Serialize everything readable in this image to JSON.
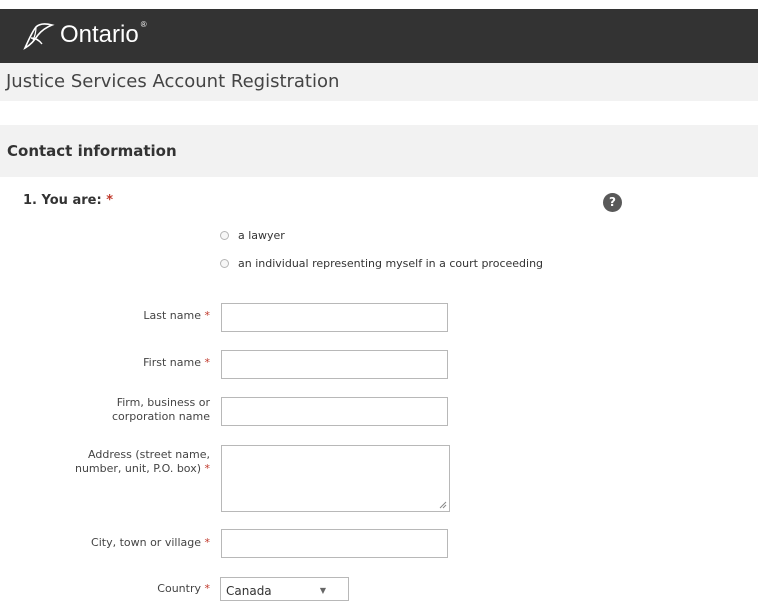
{
  "header": {
    "logo_text": "Ontario",
    "logo_mark": "trillium-logo",
    "tm": "®"
  },
  "page": {
    "title": "Justice Services Account Registration"
  },
  "section": {
    "title": "Contact information"
  },
  "question1": {
    "label": "1. You are:",
    "required_mark": "*",
    "help_icon": "?",
    "options": [
      "a lawyer",
      "an individual representing myself in a court proceeding"
    ]
  },
  "fields": {
    "last_name": {
      "label": "Last name",
      "required_mark": "*",
      "value": ""
    },
    "first_name": {
      "label": "First name",
      "required_mark": "*",
      "value": ""
    },
    "firm": {
      "label_line1": "Firm, business or",
      "label_line2": "corporation name",
      "value": ""
    },
    "address": {
      "label_line1": "Address (street name,",
      "label_line2": "number, unit, P.O. box)",
      "required_mark": "*",
      "value": ""
    },
    "city": {
      "label": "City, town or village",
      "required_mark": "*",
      "value": ""
    },
    "country": {
      "label": "Country",
      "required_mark": "*",
      "selected": "Canada",
      "caret": "▼"
    }
  },
  "colors": {
    "header_bg": "#333333",
    "panel_bg": "#f2f2f2",
    "required": "#c0392b"
  }
}
